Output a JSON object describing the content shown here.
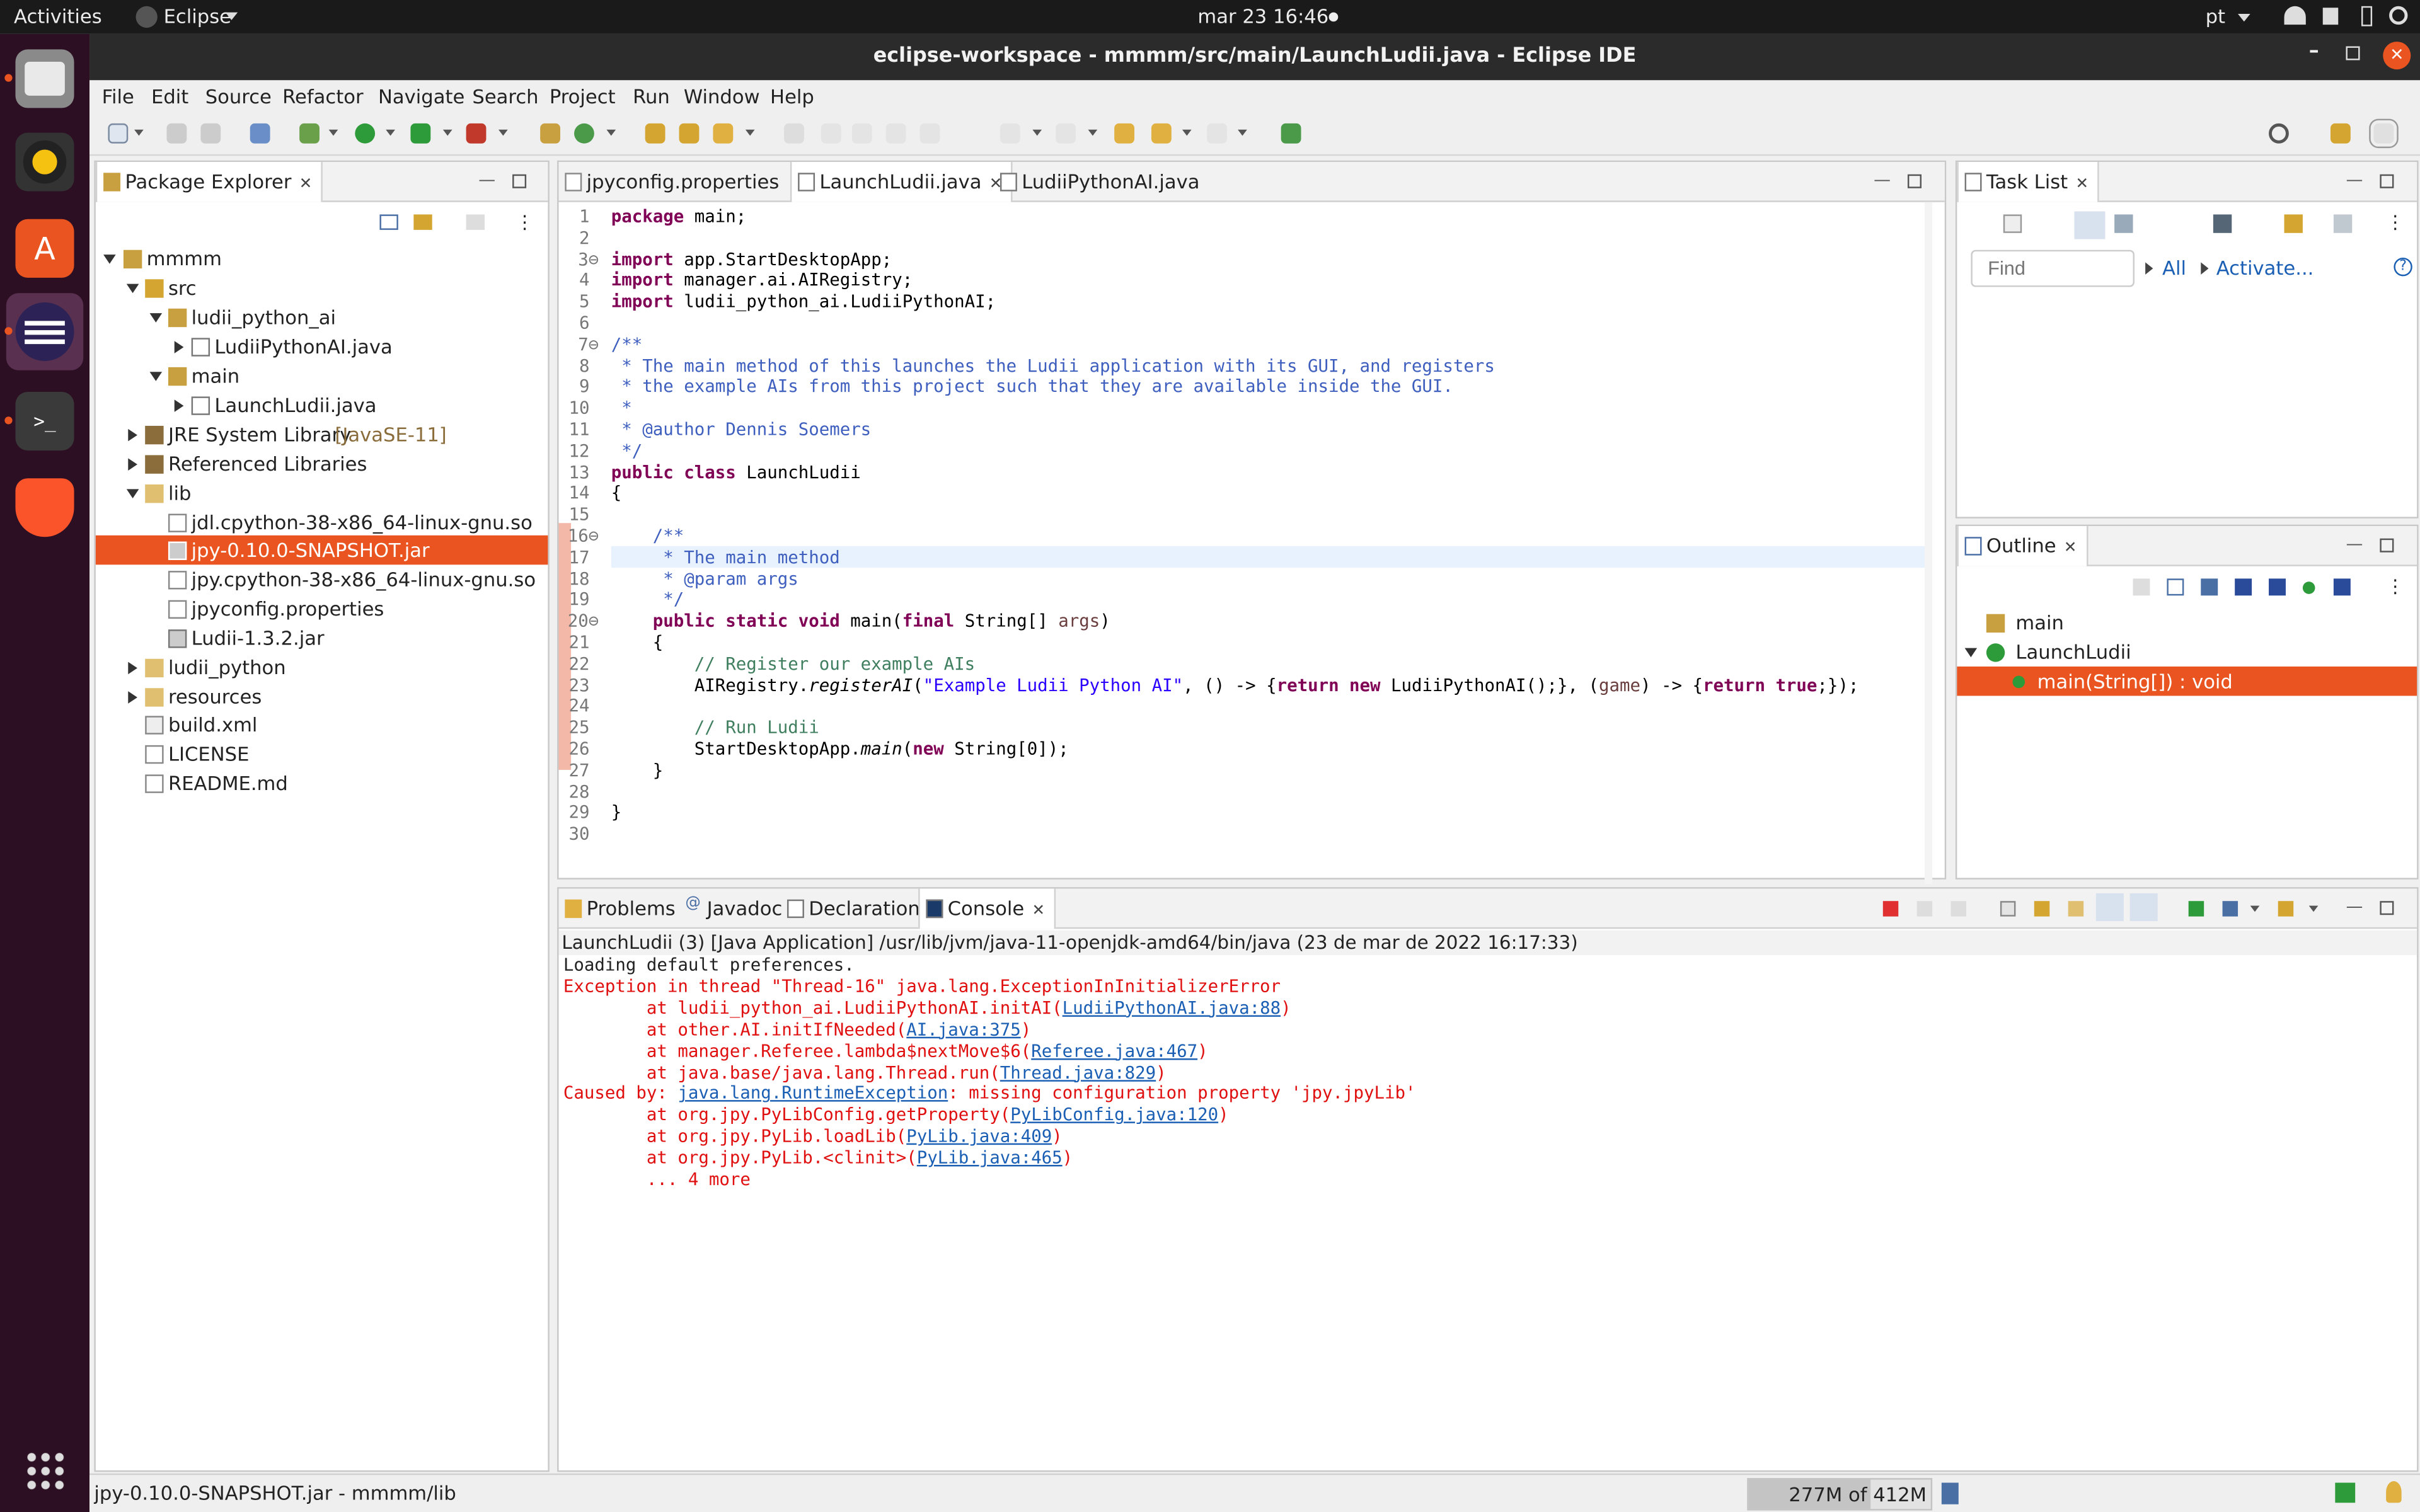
{
  "topbar": {
    "activities": "Activities",
    "app": "Eclipse",
    "clock": "mar 23  16:46",
    "lang": "pt"
  },
  "window": {
    "title": "eclipse-workspace - mmmm/src/main/LaunchLudii.java - Eclipse IDE"
  },
  "menu": [
    "File",
    "Edit",
    "Source",
    "Refactor",
    "Navigate",
    "Search",
    "Project",
    "Run",
    "Window",
    "Help"
  ],
  "package_explorer": {
    "tab": "Package Explorer",
    "items": [
      {
        "label": "mmmm"
      },
      {
        "label": "src"
      },
      {
        "label": "ludii_python_ai"
      },
      {
        "label": "LudiiPythonAI.java"
      },
      {
        "label": "main"
      },
      {
        "label": "LaunchLudii.java"
      },
      {
        "label": "JRE System Library",
        "suffix": "[JavaSE-11]"
      },
      {
        "label": "Referenced Libraries"
      },
      {
        "label": "lib"
      },
      {
        "label": "jdl.cpython-38-x86_64-linux-gnu.so"
      },
      {
        "label": "jpy-0.10.0-SNAPSHOT.jar"
      },
      {
        "label": "jpy.cpython-38-x86_64-linux-gnu.so"
      },
      {
        "label": "jpyconfig.properties"
      },
      {
        "label": "Ludii-1.3.2.jar"
      },
      {
        "label": "ludii_python"
      },
      {
        "label": "resources"
      },
      {
        "label": "build.xml"
      },
      {
        "label": "LICENSE"
      },
      {
        "label": "README.md"
      }
    ]
  },
  "editor": {
    "tabs": [
      "jpyconfig.properties",
      "LaunchLudii.java",
      "LudiiPythonAI.java"
    ],
    "lines": {
      "l1_kw": "package",
      "l1_rest": " main;",
      "l3_kw": "import",
      "l3_rest": " app.StartDesktopApp;",
      "l4_kw": "import",
      "l4_rest": " manager.ai.AIRegistry;",
      "l5_kw": "import",
      "l5_rest": " ludii_python_ai.LudiiPythonAI;",
      "l7": "/**",
      "l8": " * The main method of this launches the Ludii application with its GUI, and registers",
      "l9": " * the example AIs from this project such that they are available inside the GUI.",
      "l10": " *",
      "l11": " * @author Dennis Soemers",
      "l12": " */",
      "l13_kw": "public class",
      "l13_rest": " LaunchLudii",
      "l14": "{",
      "l16": "    /**",
      "l17": "     * The main method",
      "l18": "     * @param args",
      "l19": "     */",
      "l20_kw1": "public static void",
      "l20_a": " main(",
      "l20_kw2": "final",
      "l20_b": " String[] ",
      "l20_p": "args",
      "l20_c": ")",
      "l21": "    {",
      "l22": "        // Register our example AIs",
      "l23_a": "        AIRegistry.",
      "l23_m": "registerAI",
      "l23_b": "(",
      "l23_s": "\"Example Ludii Python AI\"",
      "l23_c": ", () -> {",
      "l23_k1": "return new",
      "l23_d": " LudiiPythonAI();}, (",
      "l23_p": "game",
      "l23_e": ") -> {",
      "l23_k2": "return true",
      "l23_f": ";});",
      "l25": "        // Run Ludii",
      "l26_a": "        StartDesktopApp.",
      "l26_m": "main",
      "l26_b": "(",
      "l26_k": "new",
      "l26_c": " String[0]);",
      "l27": "    }",
      "l29": "}"
    }
  },
  "task_list": {
    "tab": "Task List",
    "find_placeholder": "Find",
    "all": "All",
    "activate": "Activate..."
  },
  "outline": {
    "tab": "Outline",
    "items": [
      "main",
      "LaunchLudii",
      "main(String[]) : void"
    ]
  },
  "bottom_tabs": [
    "Problems",
    "Javadoc",
    "Declaration",
    "Console"
  ],
  "console": {
    "header": "LaunchLudii (3) [Java Application] /usr/lib/jvm/java-11-openjdk-amd64/bin/java (23 de mar de 2022 16:17:33)",
    "l1": "Loading default preferences.",
    "l2": "Exception in thread \"Thread-16\" java.lang.ExceptionInInitializerError",
    "l3_a": "\tat ludii_python_ai.LudiiPythonAI.initAI(",
    "l3_link": "LudiiPythonAI.java:88",
    "l3_b": ")",
    "l4_a": "\tat other.AI.initIfNeeded(",
    "l4_link": "AI.java:375",
    "l4_b": ")",
    "l5_a": "\tat manager.Referee.lambda$nextMove$6(",
    "l5_link": "Referee.java:467",
    "l5_b": ")",
    "l6_a": "\tat java.base/java.lang.Thread.run(",
    "l6_link": "Thread.java:829",
    "l6_b": ")",
    "l7_a": "Caused by: ",
    "l7_link": "java.lang.RuntimeException",
    "l7_b": ": missing configuration property 'jpy.jpyLib'",
    "l8_a": "\tat org.jpy.PyLibConfig.getProperty(",
    "l8_link": "PyLibConfig.java:120",
    "l8_b": ")",
    "l9_a": "\tat org.jpy.PyLib.loadLib(",
    "l9_link": "PyLib.java:409",
    "l9_b": ")",
    "l10_a": "\tat org.jpy.PyLib.<clinit>(",
    "l10_link": "PyLib.java:465",
    "l10_b": ")",
    "l11": "\t... 4 more"
  },
  "status": {
    "selection": "jpy-0.10.0-SNAPSHOT.jar - mmmm/lib",
    "heap": "277M of 412M",
    "heap_used_fraction": 0.672
  },
  "icons": [
    "files-icon",
    "rhythmbox-icon",
    "software-icon",
    "eclipse-icon",
    "terminal-icon",
    "brave-icon",
    "apps-grid-icon",
    "wifi-icon",
    "volume-icon",
    "battery-icon",
    "power-icon",
    "search-icon",
    "perspective-icon"
  ]
}
